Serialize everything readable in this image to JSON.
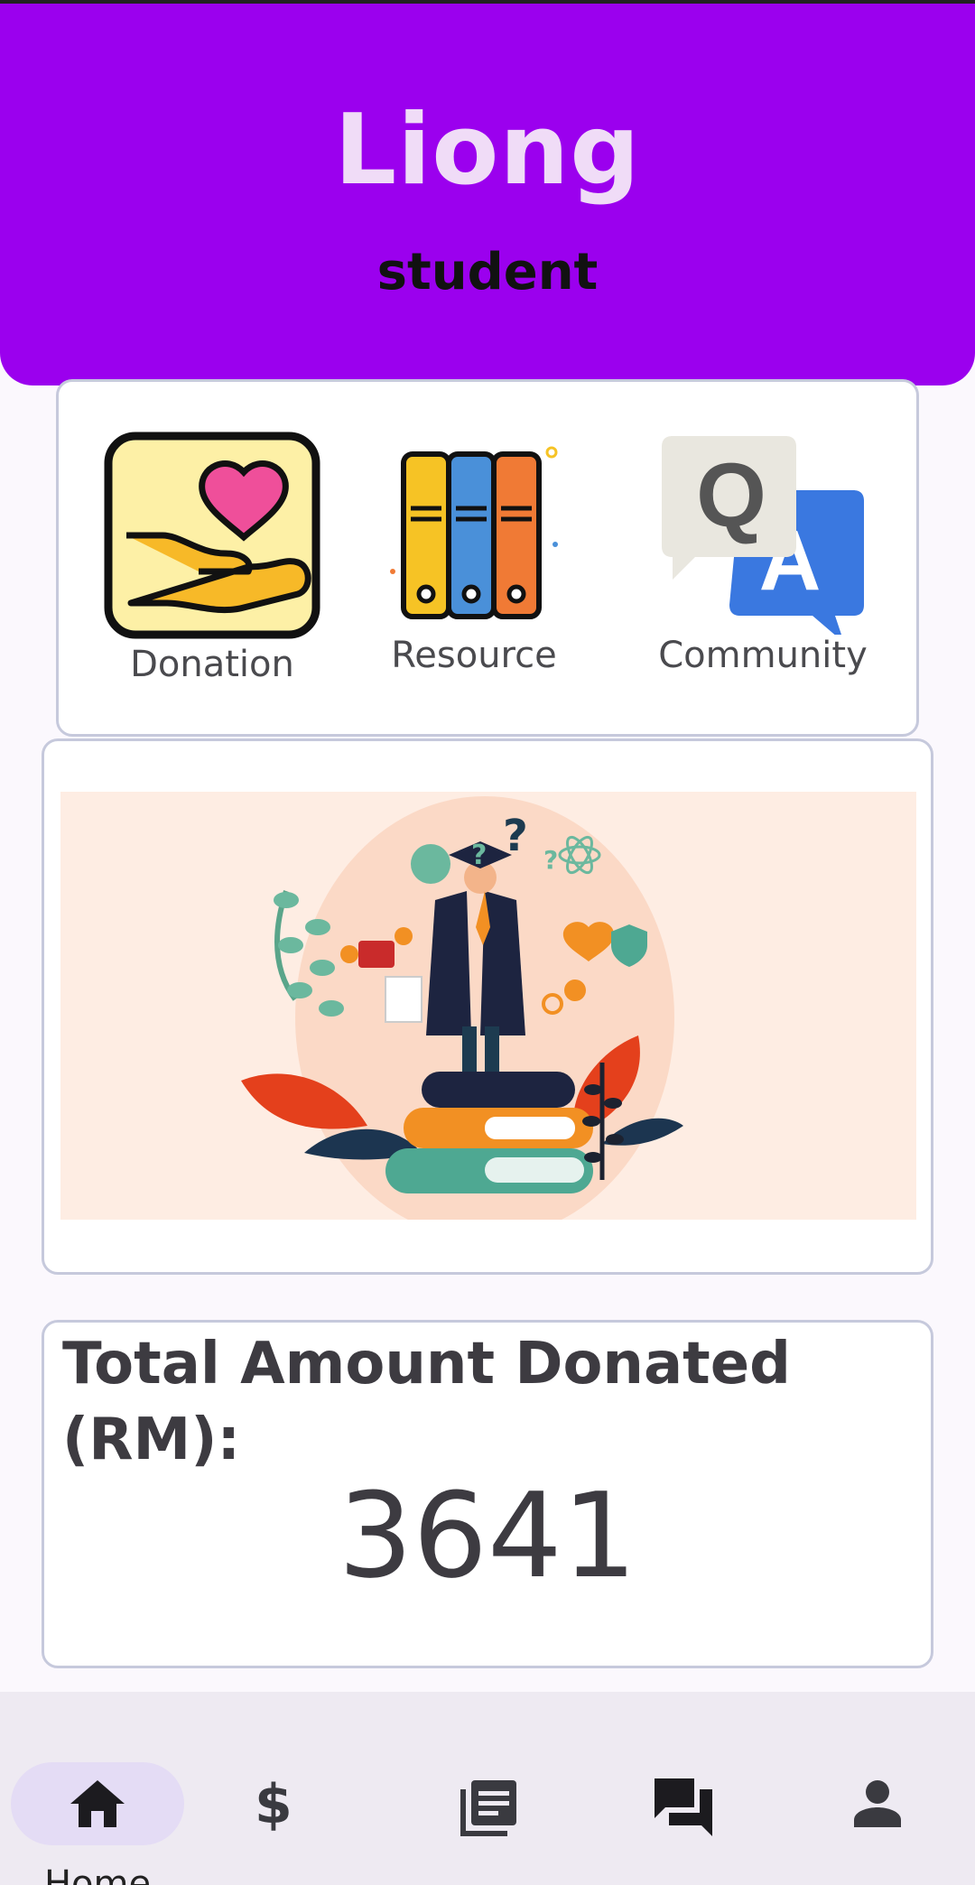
{
  "header": {
    "name": "Liong",
    "role": "student"
  },
  "menu": [
    {
      "label": "Donation",
      "icon": "donation-heart-hand-icon"
    },
    {
      "label": "Resource",
      "icon": "resource-binders-icon"
    },
    {
      "label": "Community",
      "icon": "community-qa-icon"
    }
  ],
  "banner": {
    "icon": "graduate-illustration"
  },
  "total": {
    "label": "Total Amount Donated (RM):",
    "value": "3641"
  },
  "nav": {
    "home_label": "Home",
    "items": [
      "home-icon",
      "dollar-icon",
      "book-list-icon",
      "chat-icon",
      "person-icon"
    ]
  },
  "colors": {
    "header": "#9b00ee",
    "name_text": "#f0dcf7",
    "nav_bg": "#eeeaf2",
    "nav_active_pill": "#e4dcf5",
    "banner_bg": "#feede3"
  }
}
